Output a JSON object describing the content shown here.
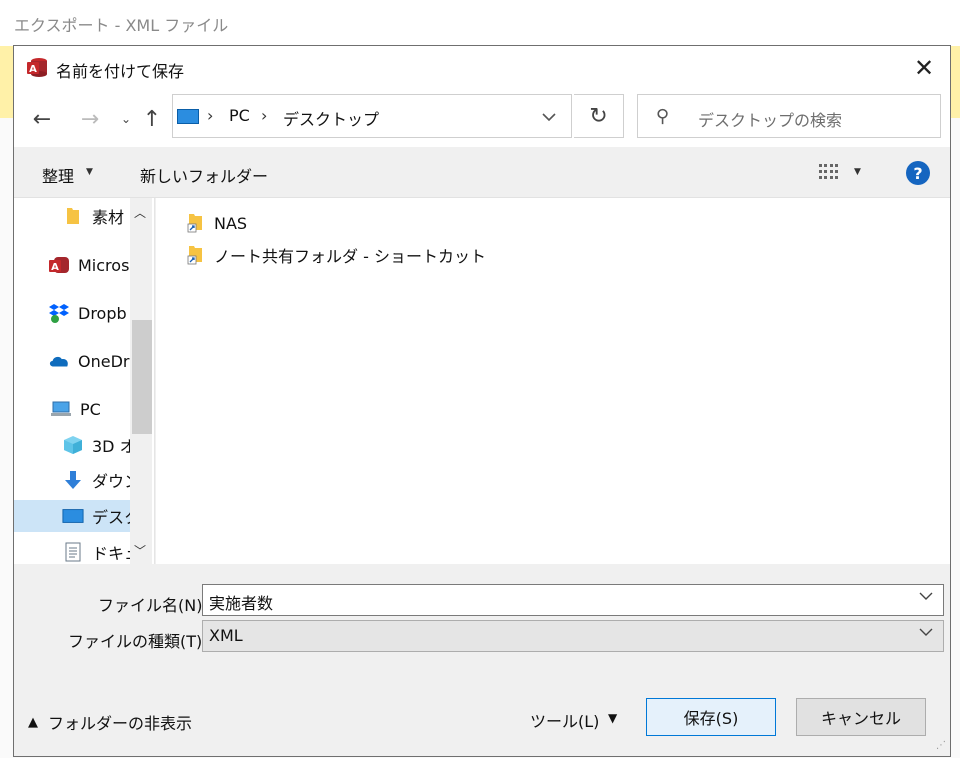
{
  "background_window": {
    "title": "エクスポート - XML ファイル"
  },
  "dialog": {
    "title": "名前を付けて保存",
    "close_label": "✕",
    "address": {
      "crumbs": [
        "PC",
        "デスクトップ"
      ]
    },
    "search": {
      "placeholder": "デスクトップの検索"
    },
    "toolbar": {
      "organize": "整理",
      "new_folder": "新しいフォルダー"
    },
    "nav_pane": {
      "items": [
        {
          "label": "素材",
          "icon": "folder-icon"
        },
        {
          "label": "Micros",
          "icon": "access-app-icon"
        },
        {
          "label": "Dropb",
          "icon": "dropbox-icon"
        },
        {
          "label": "OneDr",
          "icon": "onedrive-icon"
        },
        {
          "label": "PC",
          "icon": "pc-icon"
        },
        {
          "label": "3D オ",
          "icon": "3d-objects-icon"
        },
        {
          "label": "ダウン",
          "icon": "download-icon"
        },
        {
          "label": "デスク",
          "icon": "desktop-icon",
          "selected": true
        },
        {
          "label": "ドキュ",
          "icon": "document-icon"
        }
      ]
    },
    "files": [
      {
        "name": "NAS",
        "icon": "folder-shortcut-icon"
      },
      {
        "name": "ノート共有フォルダ - ショートカット",
        "icon": "folder-shortcut-icon"
      }
    ],
    "form": {
      "filename_label": "ファイル名(N):",
      "filename_value": "実施者数",
      "filetype_label": "ファイルの種類(T):",
      "filetype_value": "XML"
    },
    "footer": {
      "hide_folders": "フォルダーの非表示",
      "tools": "ツール(L)",
      "save": "保存(S)",
      "cancel": "キャンセル"
    }
  },
  "colors": {
    "accent": "#0078d7",
    "selected": "#cce4f7",
    "help": "#1565c0"
  }
}
